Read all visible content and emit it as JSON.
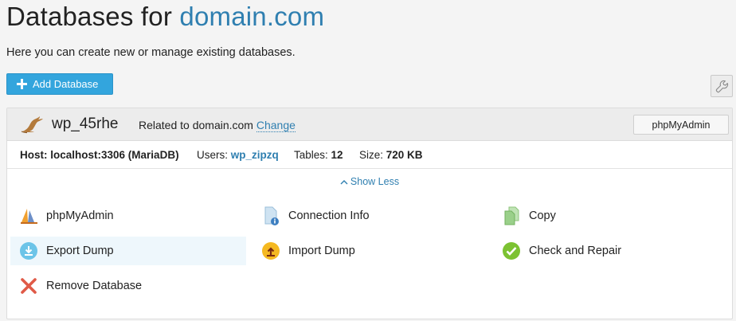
{
  "header": {
    "title_prefix": "Databases for",
    "domain": "domain.com",
    "description": "Here you can create new or manage existing databases."
  },
  "toolbar": {
    "add_database_label": "Add Database"
  },
  "database": {
    "name": "wp_45rhe",
    "related_prefix": "Related to domain.com",
    "change_label": "Change",
    "phpmyadmin_button": "phpMyAdmin",
    "host_label": "Host:",
    "host_value": "localhost:3306 (MariaDB)",
    "users_label": "Users:",
    "users_value": "wp_zipzq",
    "tables_label": "Tables:",
    "tables_value": "12",
    "size_label": "Size:",
    "size_value": "720 KB",
    "show_less_label": "Show Less",
    "actions": [
      {
        "label": "phpMyAdmin",
        "icon": "phpmyadmin-sail-icon"
      },
      {
        "label": "Connection Info",
        "icon": "connection-info-icon"
      },
      {
        "label": "Copy",
        "icon": "copy-icon"
      },
      {
        "label": "Export Dump",
        "icon": "export-dump-icon"
      },
      {
        "label": "Import Dump",
        "icon": "import-dump-icon"
      },
      {
        "label": "Check and Repair",
        "icon": "check-repair-icon"
      },
      {
        "label": "Remove Database",
        "icon": "remove-icon"
      }
    ]
  },
  "colors": {
    "accent": "#33a5dd",
    "link": "#2f7fb0",
    "check_green": "#7cc232",
    "remove_red": "#e05a47"
  }
}
